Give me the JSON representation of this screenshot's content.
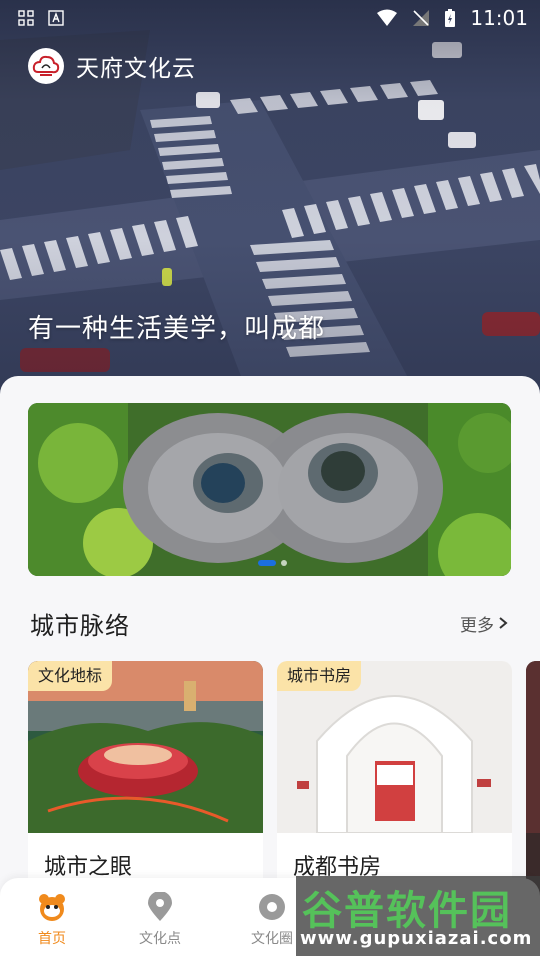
{
  "status_bar": {
    "time": "11:01",
    "icons": [
      "grid-icon",
      "a-icon",
      "wifi-icon",
      "signal-off-icon",
      "battery-charging-icon"
    ]
  },
  "header": {
    "title": "天府文化云",
    "logo_icon": "cloud-logo-icon"
  },
  "hero": {
    "slogan": "有一种生活美学，叫成都"
  },
  "banner": {
    "slides": 2,
    "active_index": 0,
    "accent": "#1b6fe0"
  },
  "section": {
    "title": "城市脉络",
    "more_label": "更多"
  },
  "cards": [
    {
      "tag": "文化地标",
      "name": "城市之眼"
    },
    {
      "tag": "城市书房",
      "name": "成都书房"
    }
  ],
  "bottom_nav": {
    "items": [
      {
        "label": "首页",
        "icon": "home-mascot-icon",
        "active": true
      },
      {
        "label": "文化点",
        "icon": "location-pin-icon",
        "active": false
      },
      {
        "label": "文化圈",
        "icon": "circle-location-icon",
        "active": false
      }
    ],
    "active_color": "#f08a1c"
  },
  "watermark": {
    "logo": "谷普软件园",
    "url": "www.gupuxiazai.com"
  }
}
